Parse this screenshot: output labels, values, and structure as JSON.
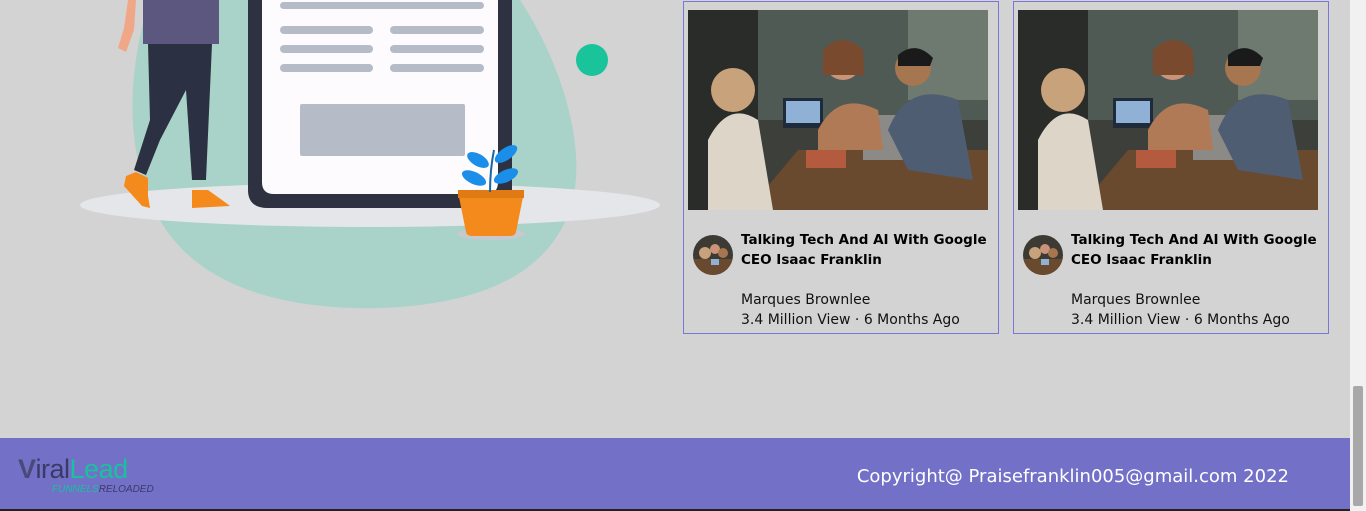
{
  "cards": [
    {
      "title": "Talking Tech And AI With Google CEO Isaac Franklin",
      "channel": "Marques Brownlee",
      "views": "3.4 Million View",
      "separator": "·",
      "age": "6 Months Ago"
    },
    {
      "title": "Talking Tech And AI With Google CEO Isaac Franklin",
      "channel": "Marques Brownlee",
      "views": "3.4 Million View",
      "separator": "·",
      "age": "6 Months Ago"
    }
  ],
  "footer": {
    "logo_v": "V",
    "logo_iral": "iral",
    "logo_lead": "Lead",
    "logo_funnels": "FUNNELS",
    "logo_reloaded": "RELOADED",
    "copyright": "Copyright@ Praisefranklin005@gmail.com  2022"
  },
  "colors": {
    "page_bg": "#d3d3d3",
    "footer_bg": "#7370c8",
    "card_border": "#7a76d3",
    "accent_green": "#18c29c"
  }
}
